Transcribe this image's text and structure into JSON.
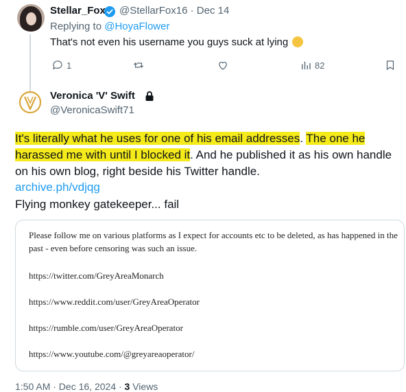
{
  "reply_tweet": {
    "author_name": "Stellar_Fox",
    "handle_date": "@StellarFox16 · Dec 14",
    "replying_prefix": "Replying to ",
    "replying_handle": "@HoyaFlower",
    "text": "That's not even his username you guys suck at lying",
    "emoji": "face-emoji",
    "reply_count": "1",
    "views_count": "82"
  },
  "main_tweet": {
    "author_name": "Veronica 'V' Swift",
    "handle": "@VeronicaSwift71",
    "body_seg1": "It's literally what he uses for one of his email addresses",
    "body_seg2": ".  ",
    "body_seg3": "The one he harassed me with until I blocked it",
    "body_seg4": ".  And he published it as his own handle on his own blog, right beside his Twitter handle.",
    "link": "archive.ph/vdjqg",
    "closing_text": "Flying monkey gatekeeper... fail",
    "timestamp": "1:50 AM · Dec 16, 2024 · ",
    "views_count": "3",
    "views_label": " Views"
  },
  "quoted_image": {
    "paragraph": "Please follow me on various platforms as I expect for accounts etc to be deleted, as has happened in the past - even before censoring was such an issue.",
    "links": [
      "https://twitter.com/GreyAreaMonarch",
      "https://www.reddit.com/user/GreyAreaOperator",
      "https://rumble.com/user/GreyAreaOperator",
      "https://www.youtube.com/@greyareaoperator/"
    ]
  },
  "colors": {
    "accent": "#1d9bf0",
    "highlight": "#f5ea1a",
    "muted": "#536471",
    "gold": "#d9a63a"
  }
}
